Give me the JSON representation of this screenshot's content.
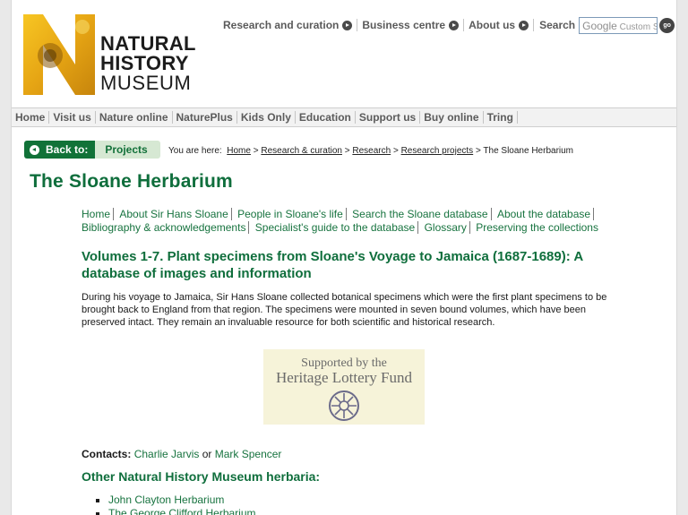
{
  "logo": {
    "line1": "NATURAL",
    "line2": "HISTORY",
    "line3": "MUSEUM"
  },
  "topnav": {
    "items": [
      "Research and curation",
      "Business centre",
      "About us"
    ],
    "search_label": "Search",
    "search_placeholder_brand": "Google",
    "search_placeholder_text": "Custom S",
    "go_label": "go"
  },
  "mainnav": [
    "Home",
    "Visit us",
    "Nature online",
    "NaturePlus",
    "Kids Only",
    "Education",
    "Support us",
    "Buy online",
    "Tring"
  ],
  "backbar": {
    "back_label": "Back to:",
    "projects_label": "Projects"
  },
  "breadcrumb": {
    "prefix": "You are here:",
    "links": [
      "Home",
      "Research & curation",
      "Research",
      "Research projects"
    ],
    "separator": ">",
    "current": "The Sloane Herbarium"
  },
  "page_title": "The Sloane Herbarium",
  "subnav": {
    "row1": [
      "Home",
      "About Sir Hans Sloane",
      "People in Sloane's life",
      "Search the Sloane database",
      "About the database"
    ],
    "row2": [
      "Bibliography & acknowledgements",
      "Specialist's guide to the database",
      "Glossary",
      "Preserving the collections"
    ]
  },
  "heading": "Volumes 1-7. Plant specimens from Sloane's Voyage to Jamaica (1687-1689): A database of images and information",
  "intro": "During his voyage to Jamaica, Sir Hans Sloane collected botanical specimens which were the first plant specimens to be brought back to England from that region. The specimens were mounted in seven bound volumes, which have been preserved intact. They remain an invaluable resource for both scientific and historical research.",
  "hlf": {
    "line1": "Supported by the",
    "line2": "Heritage Lottery Fund"
  },
  "contacts": {
    "label": "Contacts:",
    "person1": "Charlie Jarvis",
    "joiner": "or",
    "person2": "Mark Spencer"
  },
  "other_heading": "Other Natural History Museum herbaria:",
  "herbaria": [
    "John Clayton Herbarium",
    "The George Clifford Herbarium"
  ],
  "colors": {
    "brand_green": "#0f6e3c",
    "link_green": "#17733f",
    "back_green": "#117238",
    "projects_bg": "#d6e8d3"
  }
}
